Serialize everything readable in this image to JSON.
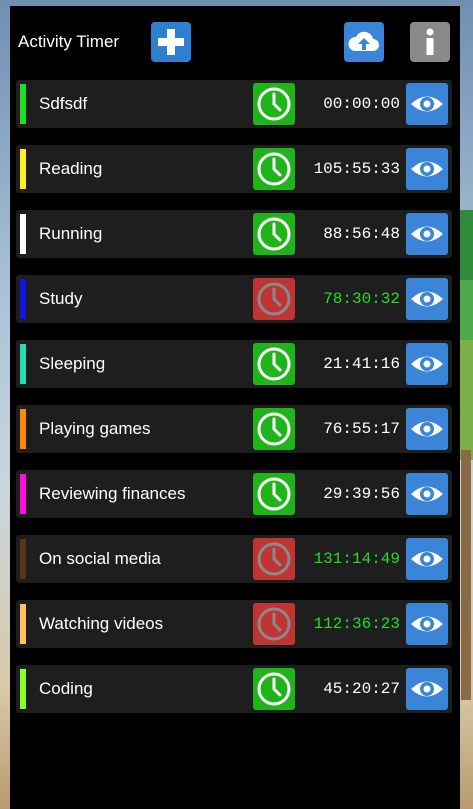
{
  "header": {
    "title": "Activity Timer",
    "add_icon": "plus-icon",
    "upload_icon": "cloud-upload-icon",
    "info_icon": "info-icon"
  },
  "colors": {
    "panel": "#000000",
    "row": "#1e1e1e",
    "button_blue": "#3b85d8",
    "timer_idle": "#1fb51a",
    "timer_running": "#c03434",
    "time_running_text": "#22dd22"
  },
  "activities": [
    {
      "name": "Sdfsdf",
      "time": "00:00:00",
      "color": "#22dd22",
      "running": false
    },
    {
      "name": "Reading",
      "time": "105:55:33",
      "color": "#ffee22",
      "running": false
    },
    {
      "name": "Running",
      "time": "88:56:48",
      "color": "#ffffff",
      "running": false
    },
    {
      "name": "Study",
      "time": "78:30:32",
      "color": "#1414e0",
      "running": true
    },
    {
      "name": "Sleeping",
      "time": "21:41:16",
      "color": "#22e0b0",
      "running": false
    },
    {
      "name": "Playing games",
      "time": "76:55:17",
      "color": "#ff8a10",
      "running": false
    },
    {
      "name": "Reviewing finances",
      "time": "29:39:56",
      "color": "#ff10e0",
      "running": false
    },
    {
      "name": "On social media",
      "time": "131:14:49",
      "color": "#5a3414",
      "running": true
    },
    {
      "name": "Watching videos",
      "time": "112:36:23",
      "color": "#ffc060",
      "running": true
    },
    {
      "name": "Coding",
      "time": "45:20:27",
      "color": "#88ff22",
      "running": false
    }
  ]
}
